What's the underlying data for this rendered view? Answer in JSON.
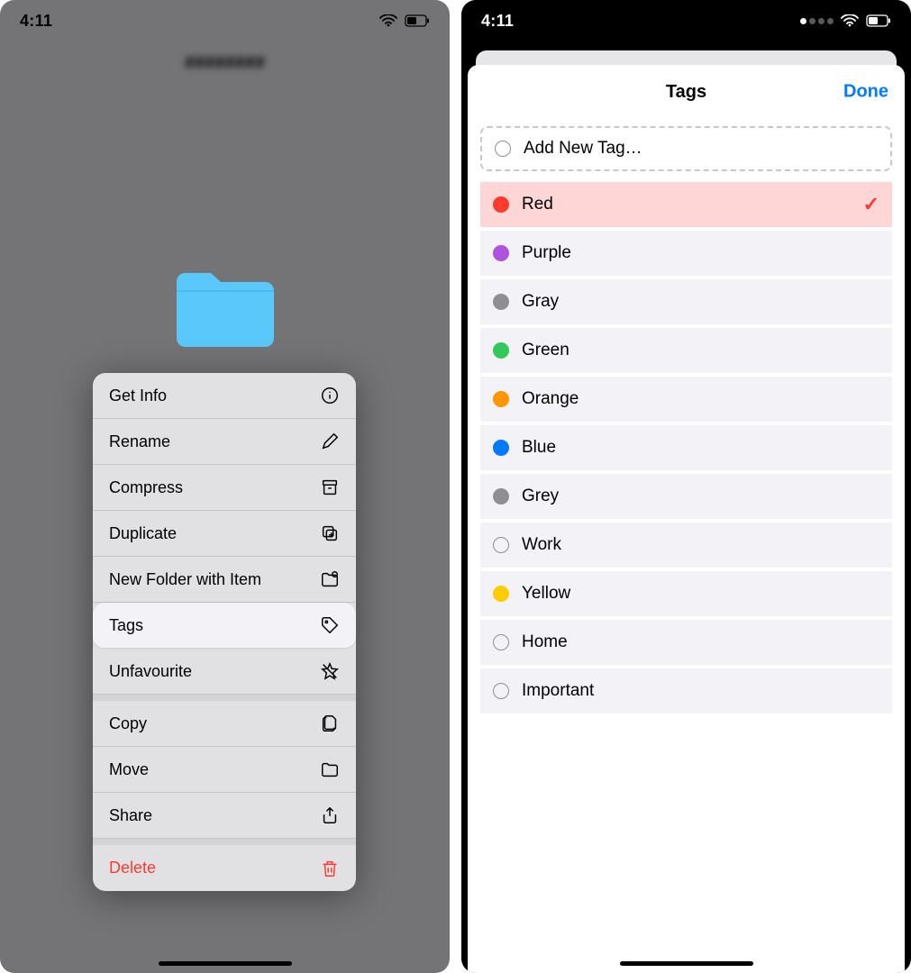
{
  "status": {
    "time": "4:11"
  },
  "left": {
    "context_menu": [
      {
        "label": "Get Info",
        "icon": "info",
        "variant": ""
      },
      {
        "label": "Rename",
        "icon": "pencil",
        "variant": ""
      },
      {
        "label": "Compress",
        "icon": "archive",
        "variant": ""
      },
      {
        "label": "Duplicate",
        "icon": "duplicate",
        "variant": ""
      },
      {
        "label": "New Folder with Item",
        "icon": "folderadd",
        "variant": ""
      },
      {
        "label": "Tags",
        "icon": "tag",
        "variant": "highlight"
      },
      {
        "label": "Unfavourite",
        "icon": "star-off",
        "variant": ""
      },
      {
        "label": "Copy",
        "icon": "docs",
        "variant": "gap"
      },
      {
        "label": "Move",
        "icon": "folder",
        "variant": ""
      },
      {
        "label": "Share",
        "icon": "share",
        "variant": ""
      },
      {
        "label": "Delete",
        "icon": "trash",
        "variant": "danger gap"
      }
    ]
  },
  "right": {
    "sheet_title": "Tags",
    "done_label": "Done",
    "add_new_label": "Add New Tag…",
    "tags": [
      {
        "label": "Red",
        "color": "#ff3b30",
        "hollow": false,
        "selected": true
      },
      {
        "label": "Purple",
        "color": "#af52de",
        "hollow": false,
        "selected": false
      },
      {
        "label": "Gray",
        "color": "#8e8e93",
        "hollow": false,
        "selected": false
      },
      {
        "label": "Green",
        "color": "#34c759",
        "hollow": false,
        "selected": false
      },
      {
        "label": "Orange",
        "color": "#ff9500",
        "hollow": false,
        "selected": false
      },
      {
        "label": "Blue",
        "color": "#007aff",
        "hollow": false,
        "selected": false
      },
      {
        "label": "Grey",
        "color": "#8e8e93",
        "hollow": false,
        "selected": false
      },
      {
        "label": "Work",
        "color": "",
        "hollow": true,
        "selected": false
      },
      {
        "label": "Yellow",
        "color": "#ffcc00",
        "hollow": false,
        "selected": false
      },
      {
        "label": "Home",
        "color": "",
        "hollow": true,
        "selected": false
      },
      {
        "label": "Important",
        "color": "",
        "hollow": true,
        "selected": false
      }
    ]
  }
}
